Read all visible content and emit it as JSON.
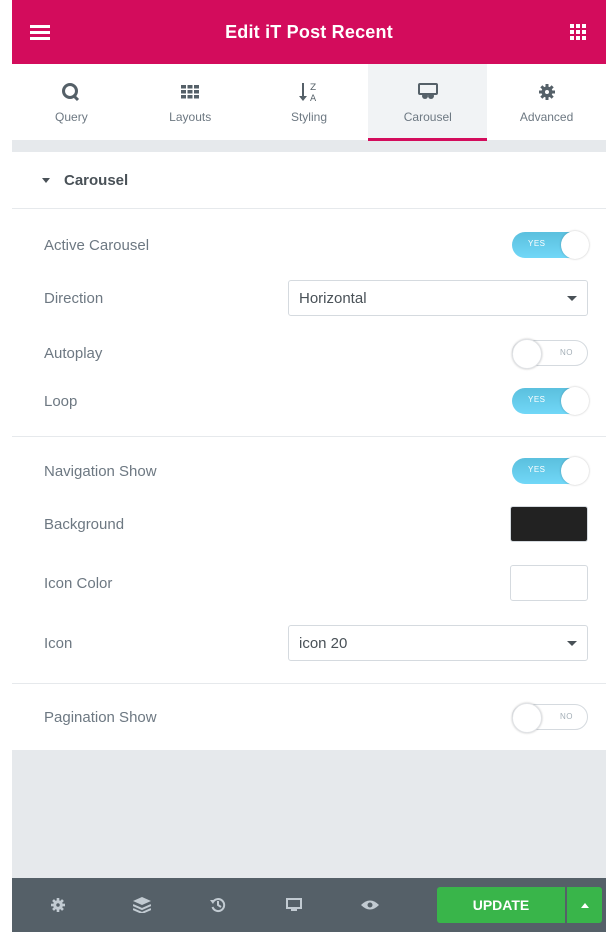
{
  "header": {
    "title": "Edit iT Post Recent"
  },
  "tabs": [
    {
      "label": "Query",
      "icon": "query-q-icon"
    },
    {
      "label": "Layouts",
      "icon": "grid-icon"
    },
    {
      "label": "Styling",
      "icon": "sort-alpha-icon"
    },
    {
      "label": "Carousel",
      "icon": "carousel-icon",
      "active": true
    },
    {
      "label": "Advanced",
      "icon": "gear-icon"
    }
  ],
  "section": {
    "title": "Carousel"
  },
  "controls": {
    "active_carousel": {
      "label": "Active Carousel",
      "state": "YES"
    },
    "direction": {
      "label": "Direction",
      "value": "Horizontal"
    },
    "autoplay": {
      "label": "Autoplay",
      "state": "NO"
    },
    "loop": {
      "label": "Loop",
      "state": "YES"
    },
    "navigation_show": {
      "label": "Navigation Show",
      "state": "YES"
    },
    "background": {
      "label": "Background",
      "color": "#222222"
    },
    "icon_color": {
      "label": "Icon Color",
      "color": "#ffffff"
    },
    "icon": {
      "label": "Icon",
      "value": "icon 20"
    },
    "pagination_show": {
      "label": "Pagination Show",
      "state": "NO"
    }
  },
  "footer": {
    "update_label": "UPDATE"
  },
  "colors": {
    "brand": "#d30c5c",
    "switch_on": "#71d7f7",
    "update": "#39b54a",
    "footer": "#556068"
  }
}
